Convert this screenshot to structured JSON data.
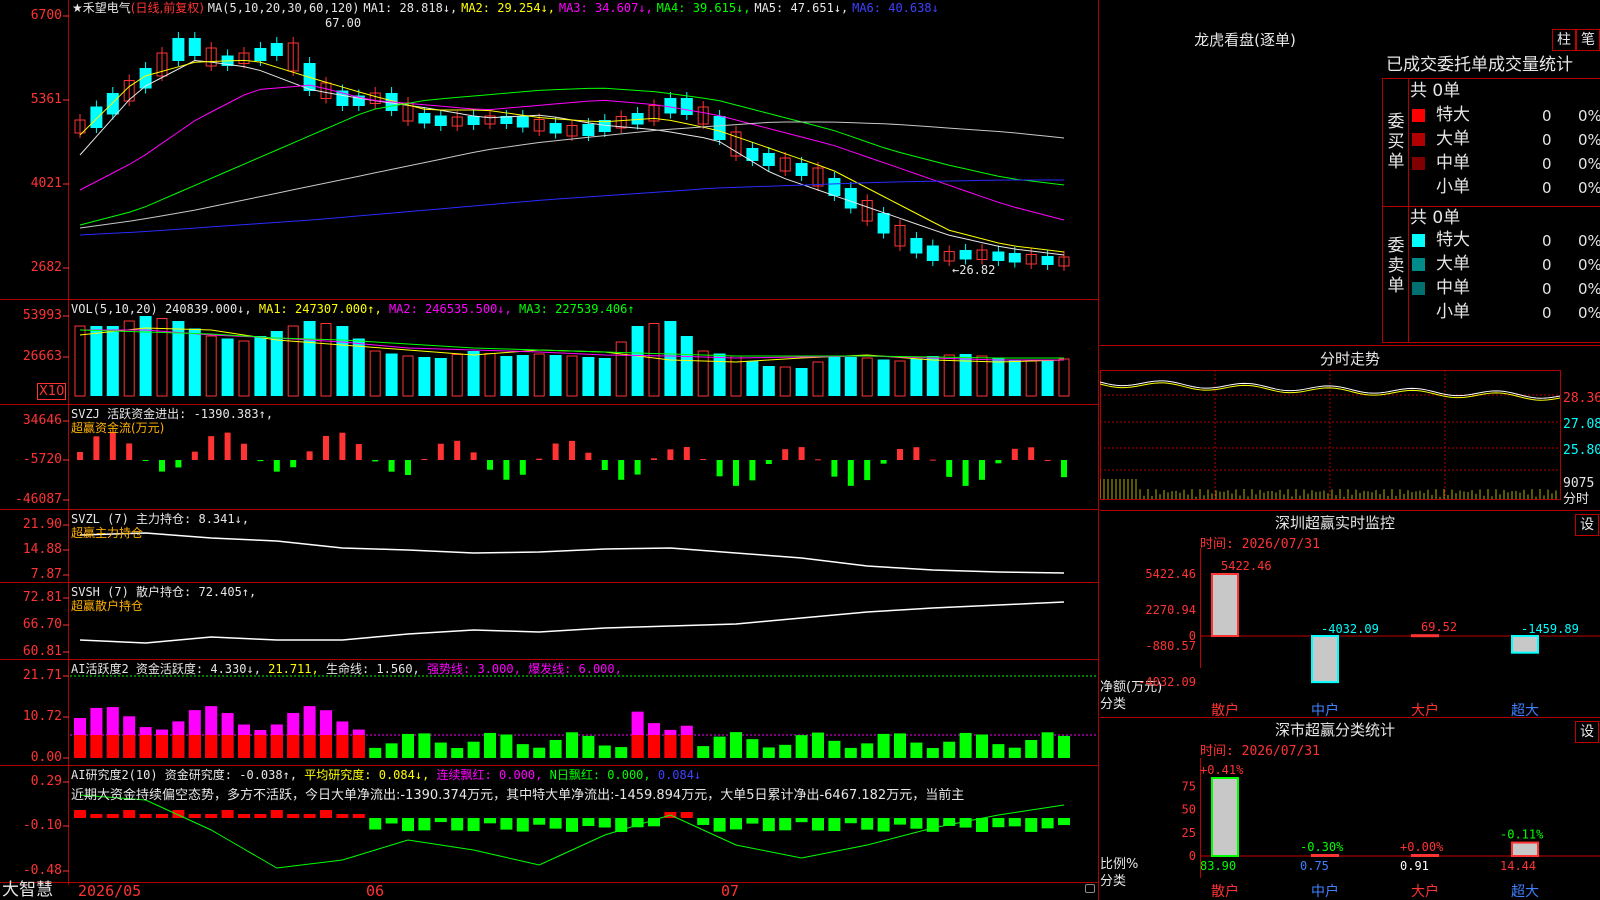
{
  "stock": {
    "star": "★",
    "name": "禾望电气",
    "period": "(日线,前复权)"
  },
  "ma": {
    "label": "MA(5,10,20,30,60,120)",
    "ma1": "MA1: 28.818↓,",
    "ma2": "MA2: 29.254↓,",
    "ma3": "MA3: 34.607↓,",
    "ma4": "MA4: 39.615↓,",
    "ma5": "MA5: 47.651↓,",
    "ma6": "MA6: 40.638↓"
  },
  "price_axis": [
    "6700",
    "5361",
    "4021",
    "2682"
  ],
  "price_markers": {
    "high": "67.00",
    "low": "←26.82"
  },
  "vol": {
    "label": "VOL(5,10,20)",
    "value": "240839.000↓,",
    "ma1": "MA1: 247307.000↑,",
    "ma2": "MA2: 246535.500↓,",
    "ma3": "MA3: 227539.406↑",
    "axis": [
      "53993",
      "26663"
    ],
    "unit": "X10"
  },
  "svzj": {
    "label": "SVZJ  活跃资金进出: -1390.383↑,",
    "sub": "超赢资金流(万元)",
    "axis": [
      "34646",
      "-5720",
      "-46087"
    ]
  },
  "svzl": {
    "label": "SVZL (7) 主力持仓: 8.341↓,",
    "sub": "超赢主力持仓",
    "axis": [
      "21.90",
      "14.88",
      "7.87"
    ]
  },
  "svsh": {
    "label": "SVSH (7) 散户持仓: 72.405↑,",
    "sub": "超赢散户持仓",
    "axis": [
      "72.81",
      "66.70",
      "60.81"
    ]
  },
  "ai1": {
    "label": "AI活跃度2 资金活跃度: 4.330↓,",
    "v2": "21.711,",
    "v3": "生命线: 1.560,",
    "v4": "强势线: 3.000,",
    "v5": "爆发线: 6.000,",
    "axis": [
      "21.71",
      "10.72",
      "0.00"
    ]
  },
  "ai2": {
    "label": "AI研究度2(10) 资金研究度: -0.038↑,",
    "v2": "平均研究度: 0.084↓,",
    "v3": "连续飘红: 0.000,",
    "v4": "N日飘红: 0.000,",
    "v5": "0.084↓",
    "note": "近期大资金持续偏空态势，多方不活跃，今日大单净流出:-1390.374万元，其中特大单净流出:-1459.894万元，大单5日累计净出-6467.182万元，当前主",
    "axis": [
      "0.29",
      "-0.10",
      "-0.48"
    ]
  },
  "date_axis": {
    "brand": "大智慧",
    "d1": "2026/05",
    "d2": "06",
    "d3": "07"
  },
  "right": {
    "header": "龙虎看盘(逐单)",
    "btn1": "柱",
    "btn2": "笔",
    "tabs": "已成交委托单成交量统计",
    "buy_side": "委买单",
    "sell_side": "委卖单",
    "buy_total": "共 0单",
    "sell_total": "共 0单",
    "buy_rows": [
      {
        "name": "特大",
        "n": "0",
        "p": "0%",
        "color": "#ff0000"
      },
      {
        "name": "大单",
        "n": "0",
        "p": "0%",
        "color": "#b00000"
      },
      {
        "name": "中单",
        "n": "0",
        "p": "0%",
        "color": "#800000"
      },
      {
        "name": "小单",
        "n": "0",
        "p": "0%",
        "color": "#000000"
      }
    ],
    "sell_rows": [
      {
        "name": "特大",
        "n": "0",
        "p": "0%",
        "color": "#00ffff"
      },
      {
        "name": "大单",
        "n": "0",
        "p": "0%",
        "color": "#008b8b"
      },
      {
        "name": "中单",
        "n": "0",
        "p": "0%",
        "color": "#007070"
      },
      {
        "name": "小单",
        "n": "0",
        "p": "0%",
        "color": "#000000"
      }
    ]
  },
  "intraday": {
    "title": "分时走势",
    "p1": "28.36",
    "p2": "27.08",
    "p3": "25.80",
    "vol": "9075",
    "unit": "分时"
  },
  "monitor": {
    "title": "深圳超赢实时监控",
    "btn": "设",
    "time": "时间: 2026/07/31",
    "axis": [
      "5422.46",
      "2270.94",
      "0",
      "-880.57",
      "-4032.09"
    ],
    "ylabel": "净额(万元)",
    "xlabel": "分类",
    "bars": [
      {
        "cat": "散户",
        "val": "5422.46",
        "num": 5422.46
      },
      {
        "cat": "中户",
        "val": "-4032.09",
        "num": -4032.09
      },
      {
        "cat": "大户",
        "val": "69.52",
        "num": 69.52
      },
      {
        "cat": "超大",
        "val": "-1459.89",
        "num": -1459.89
      }
    ]
  },
  "classify": {
    "title": "深市超赢分类统计",
    "btn": "设",
    "time": "时间: 2026/07/31",
    "axis": [
      "75",
      "50",
      "25",
      "0"
    ],
    "ylabel": "比例%",
    "xlabel": "分类",
    "bars": [
      {
        "cat": "散户",
        "top": "+0.41%",
        "val": "83.90",
        "num": 83.9
      },
      {
        "cat": "中户",
        "top": "-0.30%",
        "val": "0.75",
        "num": 0.75
      },
      {
        "cat": "大户",
        "top": "+0.00%",
        "val": "0.91",
        "num": 0.91
      },
      {
        "cat": "超大",
        "top": "-0.11%",
        "val": "14.44",
        "num": 14.44
      }
    ]
  }
}
